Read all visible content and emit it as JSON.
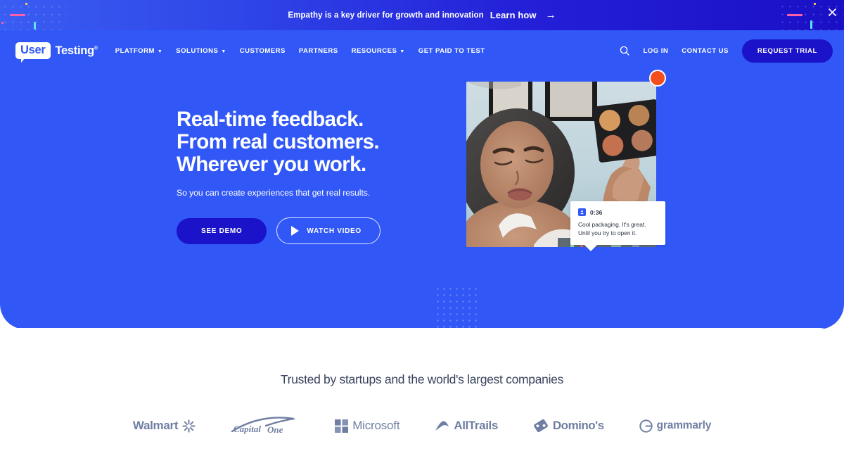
{
  "banner": {
    "message": "Empathy is a key driver for growth and innovation",
    "link_label": "Learn how",
    "arrow": "→",
    "close_icon": "close-icon",
    "gradient_from": "#3a5df2",
    "gradient_to": "#1a10c6"
  },
  "nav": {
    "logo": {
      "badge_text": "User",
      "word_text": "Testing",
      "tm": "®"
    },
    "items": [
      {
        "label": "PLATFORM",
        "has_dropdown": true
      },
      {
        "label": "SOLUTIONS",
        "has_dropdown": true
      },
      {
        "label": "CUSTOMERS",
        "has_dropdown": false
      },
      {
        "label": "PARTNERS",
        "has_dropdown": false
      },
      {
        "label": "RESOURCES",
        "has_dropdown": true
      },
      {
        "label": "GET PAID TO TEST",
        "has_dropdown": false
      }
    ],
    "search_icon": "search-icon",
    "log_in": "LOG IN",
    "contact_us": "CONTACT US",
    "request_trial": "REQUEST TRIAL",
    "trial_color": "#1a13c9"
  },
  "hero": {
    "background_color": "#3158f6",
    "headline_lines": [
      "Real-time feedback.",
      "From real customers.",
      "Wherever you work."
    ],
    "subheadline": "So you can create experiences that get real results.",
    "primary_cta": "SEE DEMO",
    "secondary_cta": "WATCH VIDEO",
    "play_icon": "play-icon",
    "record_indicator": "record-dot-icon",
    "record_color": "#f24e1e",
    "video_caption": {
      "icon": "participant-icon",
      "timestamp": "0:36",
      "line1": "Cool packaging. It's great.",
      "line2": "Until you try to open it."
    }
  },
  "trusted": {
    "title": "Trusted by startups and the world's largest companies",
    "logos": [
      {
        "name": "Walmart",
        "icon": "walmart-spark-icon"
      },
      {
        "name": "CapitalOne",
        "icon": "capitalone-swoosh-icon"
      },
      {
        "name": "Microsoft",
        "icon": "microsoft-squares-icon"
      },
      {
        "name": "AllTrails",
        "icon": "alltrails-mountain-icon"
      },
      {
        "name": "Domino's",
        "icon": "dominos-tile-icon"
      },
      {
        "name": "grammarly",
        "icon": "grammarly-g-icon"
      }
    ]
  }
}
